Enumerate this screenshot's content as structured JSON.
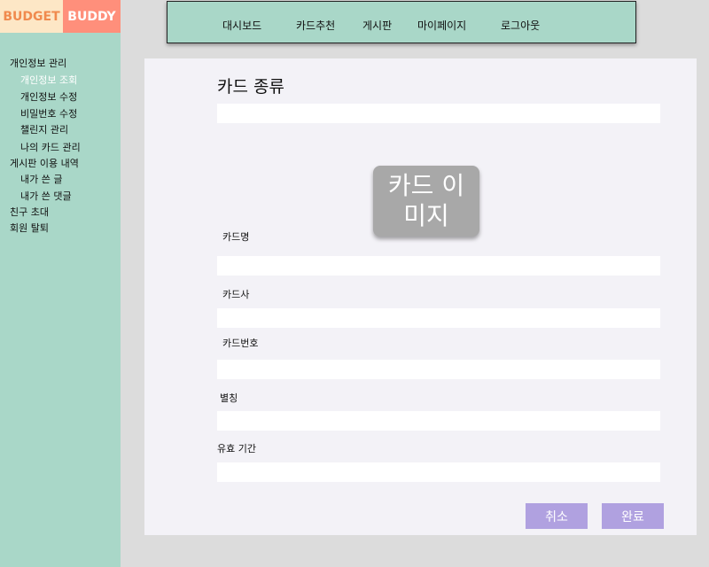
{
  "logo": {
    "left": "BUDGET",
    "right": "BUDDY"
  },
  "nav": {
    "items": [
      "대시보드",
      "카드추천",
      "게시판",
      "마이페이지",
      "로그아웃"
    ]
  },
  "sidebar": {
    "items": [
      {
        "label": "개인정보 관리"
      },
      {
        "label": "개인정보 조회",
        "active": true
      },
      {
        "label": "개인정보 수정"
      },
      {
        "label": "비밀번호 수정"
      },
      {
        "label": "챌린지 관리"
      },
      {
        "label": "나의 카드 관리"
      },
      {
        "label": "게시판 이용 내역"
      },
      {
        "label": "내가 쓴 글"
      },
      {
        "label": "내가 쓴 댓글"
      },
      {
        "label": "친구 초대"
      },
      {
        "label": "회원 탈퇴"
      }
    ]
  },
  "form": {
    "title": "카드 종류",
    "card_image_text": "카드 이미지",
    "fields": [
      {
        "label": "카드명",
        "value": ""
      },
      {
        "label": "카드사",
        "value": ""
      },
      {
        "label": "카드번호",
        "value": ""
      },
      {
        "label": "별칭",
        "value": ""
      },
      {
        "label": "유효 기간",
        "value": ""
      }
    ],
    "card_type_value": "",
    "cancel_label": "취소",
    "submit_label": "완료"
  },
  "colors": {
    "accent_mint": "#a9d7c8",
    "logo_peach": "#fde7c6",
    "logo_coral": "#ff8f7b",
    "button_purple": "#b0a1e0",
    "panel_bg": "#f3f2f7"
  }
}
